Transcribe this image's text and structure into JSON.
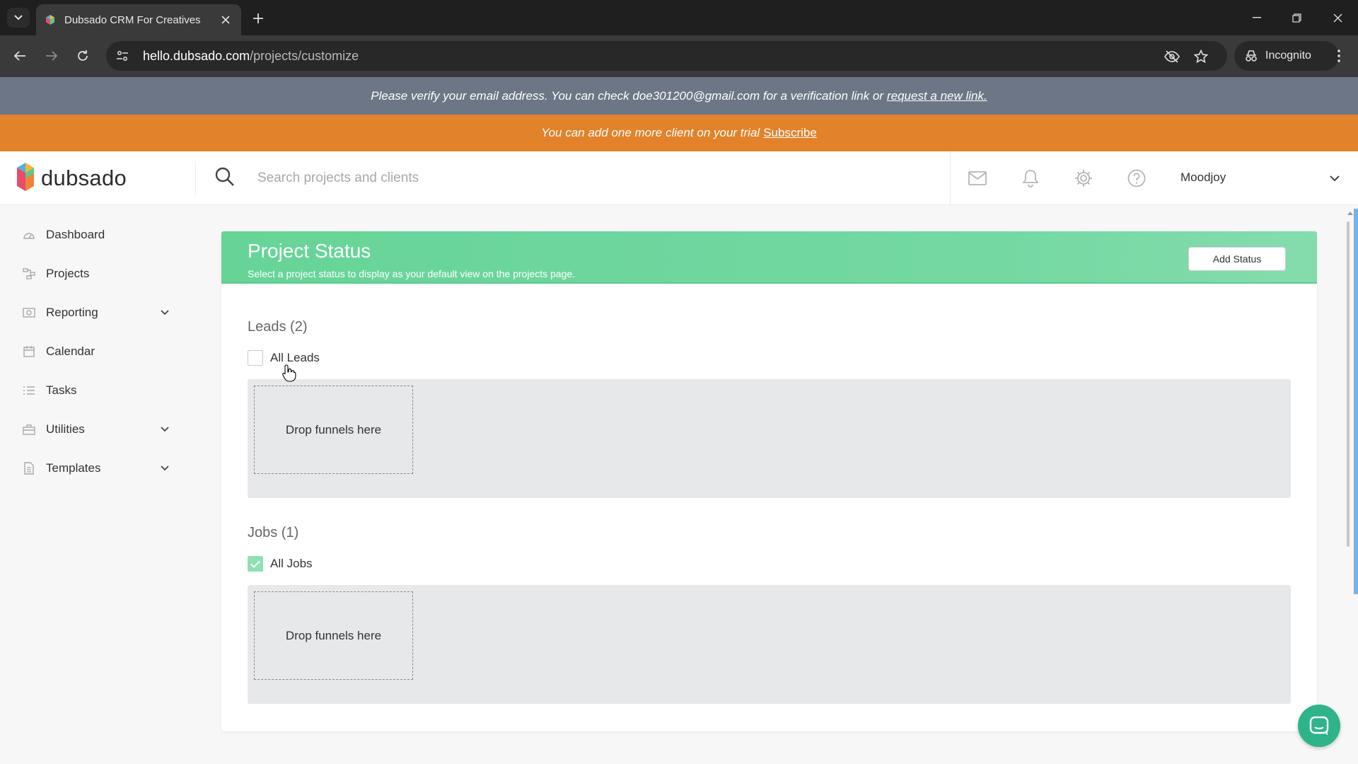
{
  "browser": {
    "tab_title": "Dubsado CRM For Creatives",
    "url_host": "hello.dubsado.com",
    "url_path": "/projects/customize",
    "incognito_label": "Incognito"
  },
  "banners": {
    "verify_text": "Please verify your email address. You can check doe301200@gmail.com for a verification link or",
    "verify_link": "request a new link.",
    "trial_text": "You can add one more client on your trial",
    "trial_link": "Subscribe"
  },
  "header": {
    "logo_text": "dubsado",
    "search_placeholder": "Search projects and clients",
    "user_name": "Moodjoy"
  },
  "sidebar": {
    "items": [
      {
        "label": "Dashboard",
        "icon": "dashboard-icon",
        "expandable": false
      },
      {
        "label": "Projects",
        "icon": "projects-icon",
        "expandable": false
      },
      {
        "label": "Reporting",
        "icon": "reporting-icon",
        "expandable": true
      },
      {
        "label": "Calendar",
        "icon": "calendar-icon",
        "expandable": false
      },
      {
        "label": "Tasks",
        "icon": "tasks-icon",
        "expandable": false
      },
      {
        "label": "Utilities",
        "icon": "utilities-icon",
        "expandable": true
      },
      {
        "label": "Templates",
        "icon": "templates-icon",
        "expandable": true
      }
    ]
  },
  "card": {
    "title": "Project Status",
    "subtitle": "Select a project status to display as your default view on the projects page.",
    "add_status_label": "Add Status",
    "sections": [
      {
        "title": "Leads (2)",
        "checkbox_label": "All Leads",
        "checked": false,
        "drop_label": "Drop funnels here"
      },
      {
        "title": "Jobs (1)",
        "checkbox_label": "All Jobs",
        "checked": true,
        "drop_label": "Drop funnels here"
      }
    ]
  },
  "colors": {
    "verify_banner": "#6c7686",
    "trial_banner": "#e2822a",
    "card_header": "#6ed59c",
    "chat_button": "#2fb38a",
    "checked": "#8fe0b4"
  }
}
